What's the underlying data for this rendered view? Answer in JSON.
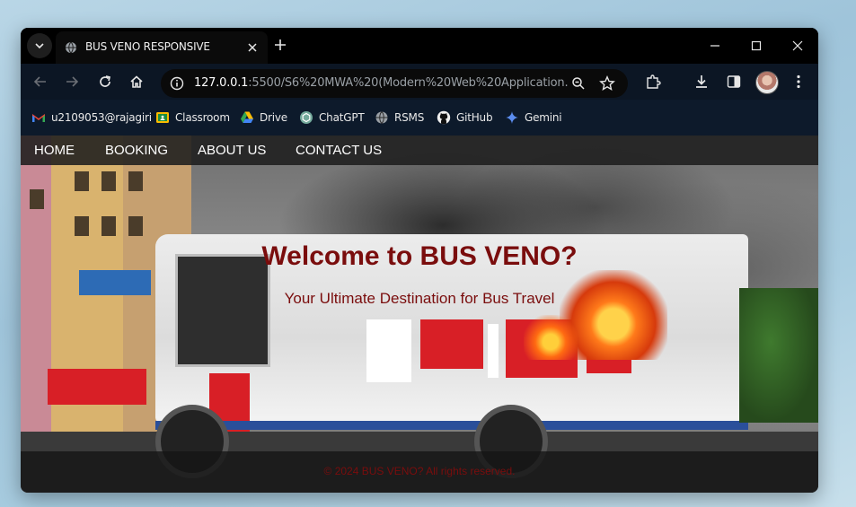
{
  "browser": {
    "tab_title": "BUS VENO RESPONSIVE",
    "url_host": "127.0.0.1",
    "url_rest": ":5500/S6%20MWA%20(Modern%20Web%20Application...",
    "bookmarks": [
      {
        "label": "u2109053@rajagiri",
        "icon": "gmail-icon"
      },
      {
        "label": "Classroom",
        "icon": "classroom-icon"
      },
      {
        "label": "Drive",
        "icon": "drive-icon"
      },
      {
        "label": "ChatGPT",
        "icon": "chatgpt-icon"
      },
      {
        "label": "RSMS",
        "icon": "globe-icon"
      },
      {
        "label": "GitHub",
        "icon": "github-icon"
      },
      {
        "label": "Gemini",
        "icon": "gemini-icon"
      }
    ]
  },
  "nav": {
    "items": [
      "HOME",
      "BOOKING",
      "ABOUT US",
      "CONTACT US"
    ]
  },
  "hero": {
    "title": "Welcome to BUS VENO?",
    "subtitle": "Your Ultimate Destination for Bus Travel"
  },
  "footer": {
    "text": "© 2024 BUS VENO? All rights reserved."
  },
  "colors": {
    "hero_text": "#7a0d0d",
    "menu_bg": "#1e1e1e"
  }
}
